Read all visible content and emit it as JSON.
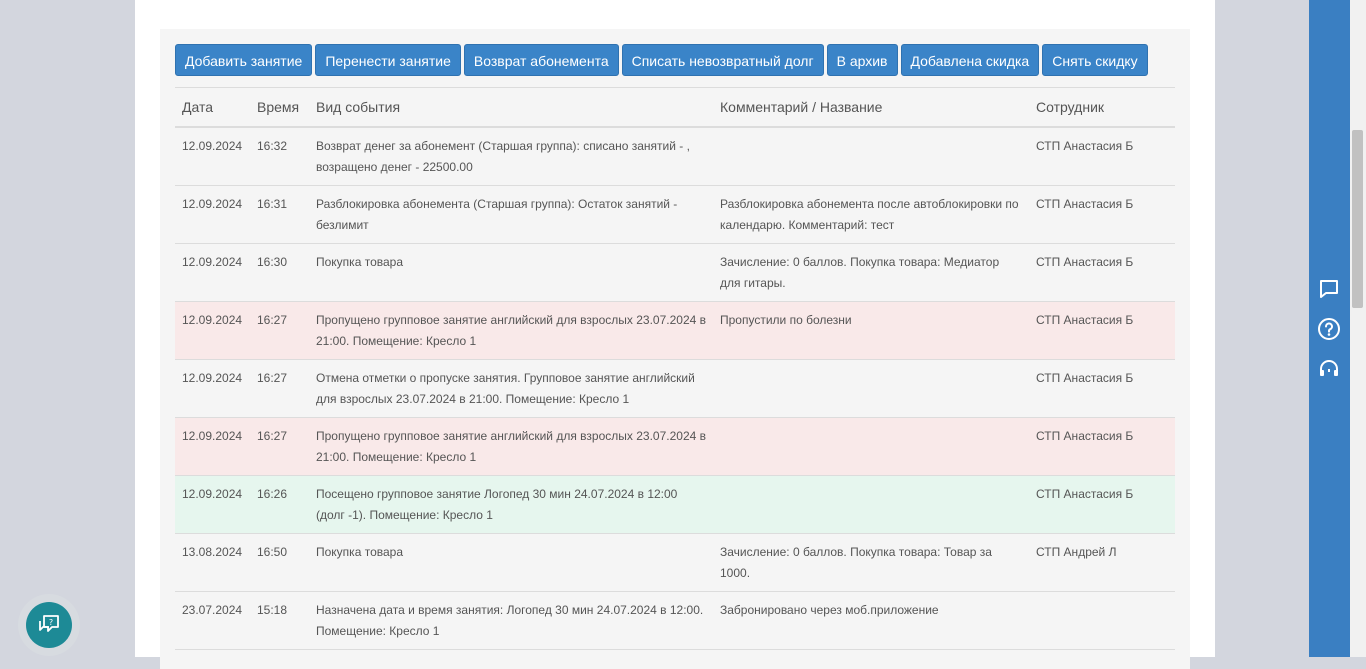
{
  "toolbar": {
    "buttons": [
      "Добавить занятие",
      "Перенести занятие",
      "Возврат абонемента",
      "Списать невозвратный долг",
      "В архив",
      "Добавлена скидка",
      "Снять скидку"
    ]
  },
  "table": {
    "headers": [
      "Дата",
      "Время",
      "Вид события",
      "Комментарий / Название",
      "Сотрудник"
    ],
    "rows": [
      {
        "status": "normal",
        "date": "12.09.2024",
        "time": "16:32",
        "event": "Возврат денег за абонемент (Старшая группа): списано занятий - , возращено денег - 22500.00",
        "comment": "",
        "employee": "СТП Анастасия Б"
      },
      {
        "status": "normal",
        "date": "12.09.2024",
        "time": "16:31",
        "event": "Разблокировка абонемента (Старшая группа): Остаток занятий - безлимит",
        "comment": "Разблокировка абонемента после автоблокировки по календарю. Комментарий: тест",
        "employee": "СТП Анастасия Б"
      },
      {
        "status": "normal",
        "date": "12.09.2024",
        "time": "16:30",
        "event": "Покупка товара",
        "comment": "Зачисление: 0 баллов. Покупка товара: Медиатор для гитары.",
        "employee": "СТП Анастасия Б"
      },
      {
        "status": "danger",
        "date": "12.09.2024",
        "time": "16:27",
        "event": "Пропущено групповое занятие английский для взрослых 23.07.2024 в 21:00. Помещение: Кресло 1",
        "comment": "Пропустили по болезни",
        "employee": "СТП Анастасия Б"
      },
      {
        "status": "normal",
        "date": "12.09.2024",
        "time": "16:27",
        "event": "Отмена отметки о пропуске занятия. Групповое занятие английский для взрослых 23.07.2024 в 21:00. Помещение: Кресло 1",
        "comment": "",
        "employee": "СТП Анастасия Б"
      },
      {
        "status": "danger",
        "date": "12.09.2024",
        "time": "16:27",
        "event": "Пропущено групповое занятие английский для взрослых 23.07.2024 в 21:00. Помещение: Кресло 1",
        "comment": "",
        "employee": "СТП Анастасия Б"
      },
      {
        "status": "success",
        "date": "12.09.2024",
        "time": "16:26",
        "event": "Посещено групповое занятие Логопед 30 мин 24.07.2024 в 12:00 (долг -1). Помещение: Кресло 1",
        "comment": "",
        "employee": "СТП Анастасия Б"
      },
      {
        "status": "normal",
        "date": "13.08.2024",
        "time": "16:50",
        "event": "Покупка товара",
        "comment": "Зачисление: 0 баллов. Покупка товара: Товар за 1000.",
        "employee": "СТП Андрей Л"
      },
      {
        "status": "normal",
        "date": "23.07.2024",
        "time": "15:18",
        "event": "Назначена дата и время занятия: Логопед 30 мин 24.07.2024 в 12:00. Помещение: Кресло 1",
        "comment": "Забронировано через моб.приложение",
        "employee": ""
      }
    ]
  },
  "sidebar_right": {
    "icons": [
      "chat-icon",
      "help-icon",
      "support-headset-icon"
    ]
  },
  "colors": {
    "button": "#3a84c8",
    "danger_row": "#f9e9e9",
    "success_row": "#e6f6ee",
    "rail": "#3a7fc2",
    "chat_button": "#1d8a96"
  }
}
